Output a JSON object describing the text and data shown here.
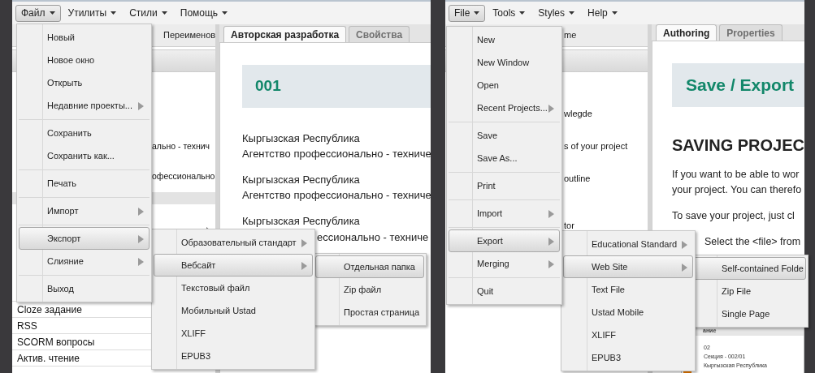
{
  "screens": [
    {
      "menubar": [
        {
          "label": "Файл",
          "selected": true
        },
        {
          "label": "Утилиты",
          "selected": false
        },
        {
          "label": "Стили",
          "selected": false
        },
        {
          "label": "Помощь",
          "selected": false
        }
      ],
      "file_menu": [
        {
          "kind": "item",
          "label": "Новый",
          "selected": false
        },
        {
          "kind": "item",
          "label": "Новое окно",
          "selected": false
        },
        {
          "kind": "item",
          "label": "Открыть",
          "selected": false
        },
        {
          "kind": "item",
          "label": "Недавние проекты...",
          "has_arrow": true,
          "selected": false
        },
        {
          "kind": "separator"
        },
        {
          "kind": "item",
          "label": "Сохранить",
          "selected": false
        },
        {
          "kind": "item",
          "label": "Сохранить как...",
          "selected": false
        },
        {
          "kind": "separator"
        },
        {
          "kind": "item",
          "label": "Печать",
          "selected": false
        },
        {
          "kind": "separator"
        },
        {
          "kind": "item",
          "label": "Импорт",
          "has_arrow": true,
          "selected": false
        },
        {
          "kind": "separator"
        },
        {
          "kind": "item",
          "label": "Экспорт",
          "has_arrow": true,
          "selected": true,
          "submenu": [
            {
              "kind": "item",
              "label": "Образовательный стандарт",
              "has_arrow": true,
              "selected": false
            },
            {
              "kind": "item",
              "label": "Вебсайт",
              "has_arrow": true,
              "selected": true,
              "submenu": [
                {
                  "kind": "item",
                  "label": "Отдельная папка",
                  "selected": true
                },
                {
                  "kind": "item",
                  "label": "Zip файл",
                  "selected": false
                },
                {
                  "kind": "item",
                  "label": "Простая страница",
                  "selected": false
                }
              ]
            },
            {
              "kind": "item",
              "label": "Текстовый файл",
              "selected": false
            },
            {
              "kind": "item",
              "label": "Мобильный Ustad",
              "selected": false
            },
            {
              "kind": "item",
              "label": "XLIFF",
              "selected": false
            },
            {
              "kind": "item",
              "label": "EPUB3",
              "selected": false
            }
          ]
        },
        {
          "kind": "item",
          "label": "Слияние",
          "has_arrow": true,
          "selected": false
        },
        {
          "kind": "separator"
        },
        {
          "kind": "item",
          "label": "Выход",
          "selected": false
        }
      ],
      "outline": {
        "tab": "Переименов",
        "fragments": [
          "ально - технич",
          "офессионально"
        ],
        "list": [
          "Cloze задание",
          "RSS",
          "SCORM вопросы",
          "Актив. чтение"
        ]
      },
      "tabs": [
        {
          "label": "Авторская разработка",
          "selected": true
        },
        {
          "label": "Свойства",
          "selected": false
        }
      ],
      "heading": "001",
      "blocks": [
        {
          "kind": "paragraph",
          "lines": [
            "Кыргызская Республика",
            "Агентство профессионально - техниче"
          ]
        },
        {
          "kind": "paragraph",
          "lines": [
            "Кыргызская Республика",
            "Агентство профессионально - техниче"
          ]
        },
        {
          "kind": "paragraph",
          "lines": [
            "Кыргызская Республика"
          ]
        },
        {
          "kind": "fragment",
          "text": "ессионально - техниче"
        }
      ]
    },
    {
      "menubar": [
        {
          "label": "File",
          "selected": true
        },
        {
          "label": "Tools",
          "selected": false
        },
        {
          "label": "Styles",
          "selected": false
        },
        {
          "label": "Help",
          "selected": false
        }
      ],
      "file_menu": [
        {
          "kind": "item",
          "label": "New",
          "selected": false
        },
        {
          "kind": "item",
          "label": "New Window",
          "selected": false
        },
        {
          "kind": "item",
          "label": "Open",
          "selected": false
        },
        {
          "kind": "item",
          "label": "Recent Projects...",
          "has_arrow": true,
          "selected": false
        },
        {
          "kind": "separator"
        },
        {
          "kind": "item",
          "label": "Save",
          "selected": false
        },
        {
          "kind": "item",
          "label": "Save As...",
          "selected": false
        },
        {
          "kind": "separator"
        },
        {
          "kind": "item",
          "label": "Print",
          "selected": false
        },
        {
          "kind": "separator"
        },
        {
          "kind": "item",
          "label": "Import",
          "has_arrow": true,
          "selected": false
        },
        {
          "kind": "separator"
        },
        {
          "kind": "item",
          "label": "Export",
          "has_arrow": true,
          "selected": true,
          "submenu": [
            {
              "kind": "item",
              "label": "Educational Standard",
              "has_arrow": true,
              "selected": false
            },
            {
              "kind": "item",
              "label": "Web Site",
              "has_arrow": true,
              "selected": true,
              "submenu": [
                {
                  "kind": "item",
                  "label": "Self-contained Folde",
                  "selected": true
                },
                {
                  "kind": "item",
                  "label": "Zip File",
                  "selected": false
                },
                {
                  "kind": "item",
                  "label": "Single Page",
                  "selected": false
                }
              ]
            },
            {
              "kind": "item",
              "label": "Text File",
              "selected": false
            },
            {
              "kind": "item",
              "label": "Ustad Mobile",
              "selected": false
            },
            {
              "kind": "item",
              "label": "XLIFF",
              "selected": false
            },
            {
              "kind": "item",
              "label": "EPUB3",
              "selected": false
            }
          ]
        },
        {
          "kind": "item",
          "label": "Merging",
          "has_arrow": true,
          "selected": false
        },
        {
          "kind": "separator"
        },
        {
          "kind": "item",
          "label": "Quit",
          "selected": false
        }
      ],
      "outline": {
        "tab": "me",
        "fragments": [
          "wlegde",
          "s of your project",
          "outline",
          "tor"
        ]
      },
      "tabs": [
        {
          "label": "Authoring",
          "selected": true
        },
        {
          "label": "Properties",
          "selected": false
        }
      ],
      "heading": "Save / Export",
      "blocks": [
        {
          "kind": "title",
          "text": "SAVING PROJEC"
        },
        {
          "kind": "paragraph",
          "lines": [
            "If you want to be able to wor",
            "your project. You can therefo"
          ]
        },
        {
          "kind": "paragraph",
          "lines": [
            "To save your project, just cl"
          ]
        },
        {
          "kind": "indented",
          "text": "Select the <file> from"
        },
        {
          "kind": "thumbnail",
          "header": "ание",
          "lines": [
            "02",
            "Секция - 002/01",
            "Кыргызская Республика"
          ]
        }
      ]
    }
  ]
}
